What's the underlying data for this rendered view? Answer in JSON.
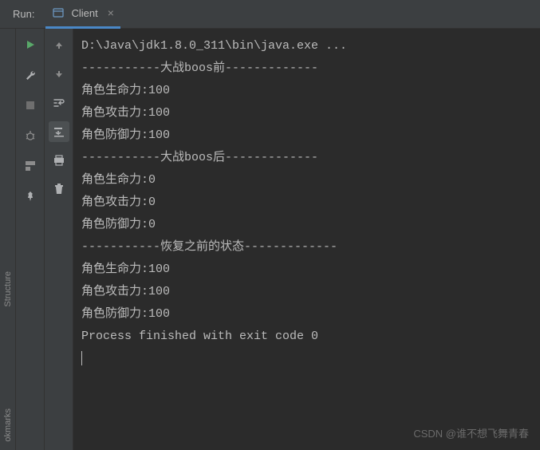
{
  "header": {
    "run_label": "Run:",
    "tab_label": "Client"
  },
  "sidebar": {
    "structure_label": "Structure",
    "bookmarks_label": "okmarks"
  },
  "console": {
    "lines": [
      "D:\\Java\\jdk1.8.0_311\\bin\\java.exe ...",
      "-----------大战boos前-------------",
      "角色生命力:100",
      "角色攻击力:100",
      "角色防御力:100",
      "-----------大战boos后-------------",
      "角色生命力:0",
      "角色攻击力:0",
      "角色防御力:0",
      "-----------恢复之前的状态-------------",
      "角色生命力:100",
      "角色攻击力:100",
      "角色防御力:100",
      "",
      "Process finished with exit code 0"
    ]
  },
  "watermark": "CSDN @谁不想飞舞青春"
}
